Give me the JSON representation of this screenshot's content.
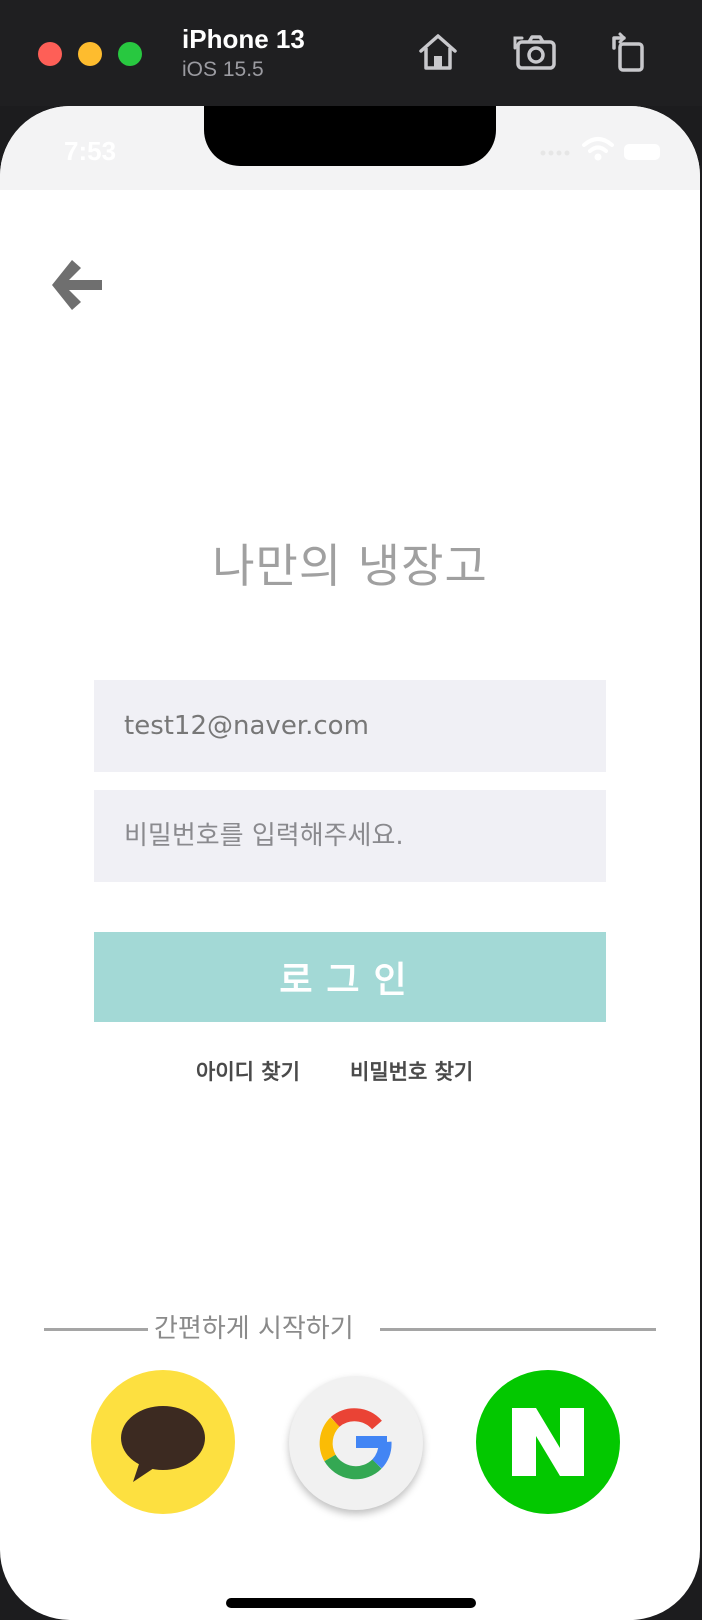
{
  "simulator": {
    "device_name": "iPhone 13",
    "os_version": "iOS 15.5",
    "toolbar_icons": [
      "home-icon",
      "screenshot-icon",
      "rotate-icon"
    ]
  },
  "statusbar": {
    "time": "7:53"
  },
  "screen": {
    "title": "나만의 냉장고",
    "email_value": "test12@naver.com",
    "password_placeholder": "비밀번호를 입력해주세요.",
    "login_label": "로그인",
    "find_id_label": "아이디 찾기",
    "find_password_label": "비밀번호 찾기",
    "social_heading": "간편하게 시작하기",
    "social_buttons": [
      "kakao-login",
      "google-login",
      "naver-login"
    ]
  },
  "colors": {
    "login_button": "#a3d9d6",
    "input_background": "#f0f0f5",
    "kakao": "#fde040",
    "naver": "#03c800"
  }
}
